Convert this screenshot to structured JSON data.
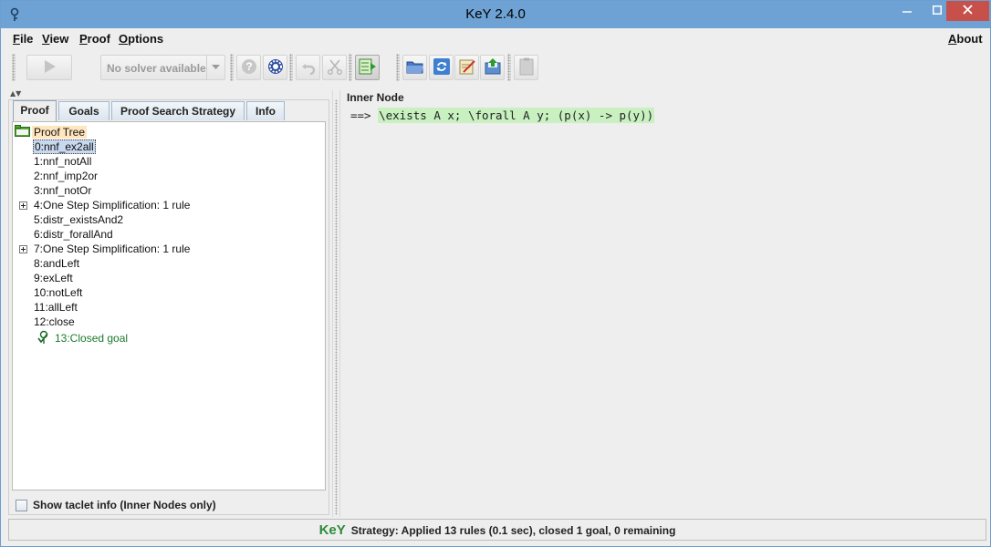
{
  "window": {
    "title": "KeY 2.4.0",
    "icons": {
      "app": "key-logo-icon",
      "minimize": "minimize-icon",
      "maximize": "maximize-icon",
      "close": "close-icon"
    }
  },
  "menubar": {
    "file": {
      "mnemonic": "F",
      "rest": "ile"
    },
    "view": {
      "mnemonic": "V",
      "rest": "iew"
    },
    "proof": {
      "mnemonic": "P",
      "rest": "roof"
    },
    "options": {
      "mnemonic": "O",
      "rest": "ptions"
    },
    "about": {
      "mnemonic": "A",
      "rest": "bout"
    }
  },
  "toolbar": {
    "buttons": [
      {
        "name": "start-auto-mode",
        "icon": "play-icon",
        "enabled": false
      },
      {
        "name": "solver-help",
        "icon": "question-icon",
        "enabled": false
      },
      {
        "name": "solver-settings",
        "icon": "gear-icon",
        "enabled": true
      },
      {
        "name": "undo",
        "icon": "undo-icon",
        "enabled": false
      },
      {
        "name": "prune",
        "icon": "scissors-icon",
        "enabled": false
      },
      {
        "name": "toggle-goal-view",
        "icon": "goal-list-icon",
        "enabled": true,
        "pressed": true
      },
      {
        "name": "open",
        "icon": "folder-icon",
        "enabled": true
      },
      {
        "name": "reload",
        "icon": "reload-icon",
        "enabled": true
      },
      {
        "name": "edit",
        "icon": "edit-icon",
        "enabled": true
      },
      {
        "name": "save",
        "icon": "save-icon",
        "enabled": true
      },
      {
        "name": "clipboard",
        "icon": "clipboard-icon",
        "enabled": false
      }
    ],
    "solver": {
      "label": "No solver available",
      "enabled": false
    }
  },
  "left_panel": {
    "tabs": [
      {
        "label": "Proof",
        "active": true
      },
      {
        "label": "Goals",
        "active": false
      },
      {
        "label": "Proof Search Strategy",
        "active": false
      },
      {
        "label": "Info",
        "active": false
      }
    ],
    "tree": {
      "root": "Proof Tree",
      "nodes": [
        {
          "label": "0:nnf_ex2all",
          "selected": true,
          "expandable": false
        },
        {
          "label": "1:nnf_notAll",
          "expandable": false
        },
        {
          "label": "2:nnf_imp2or",
          "expandable": false
        },
        {
          "label": "3:nnf_notOr",
          "expandable": false
        },
        {
          "label": "4:One Step Simplification: 1 rule",
          "expandable": true
        },
        {
          "label": "5:distr_existsAnd2",
          "expandable": false
        },
        {
          "label": "6:distr_forallAnd",
          "expandable": false
        },
        {
          "label": "7:One Step Simplification: 1 rule",
          "expandable": true
        },
        {
          "label": "8:andLeft",
          "expandable": false
        },
        {
          "label": "9:exLeft",
          "expandable": false
        },
        {
          "label": "10:notLeft",
          "expandable": false
        },
        {
          "label": "11:allLeft",
          "expandable": false
        },
        {
          "label": "12:close",
          "expandable": false
        }
      ],
      "closed_goal": "13:Closed goal"
    },
    "show_taclet_info": {
      "label": "Show taclet info (Inner Nodes only)",
      "checked": false
    }
  },
  "right_panel": {
    "title": "Inner Node",
    "sequent": {
      "arrow": "==>",
      "formula": "\\exists A x; \\forall A y; (p(x) -> p(y))"
    }
  },
  "status": {
    "logo": "KeY",
    "text": "Strategy: Applied 13 rules (0.1 sec),  closed 1 goal, 0 remaining"
  },
  "colors": {
    "titlebar": "#6ea2d4",
    "close_button": "#c7504b",
    "formula_highlight": "#c8f0c0",
    "closed_goal": "#1a7a2a",
    "root_highlight": "#ffe6bf",
    "selection": "#c8d8ee"
  }
}
